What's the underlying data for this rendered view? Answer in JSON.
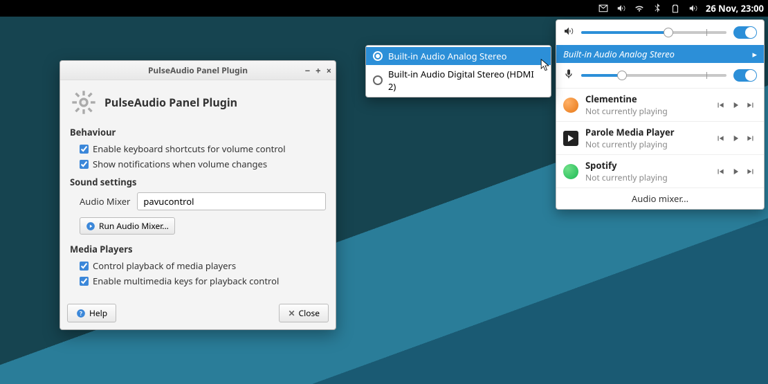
{
  "panel": {
    "clock": "26 Nov, 23:00"
  },
  "dialog": {
    "title": "PulseAudio Panel Plugin",
    "heading": "PulseAudio Panel Plugin",
    "sections": {
      "behaviour": "Behaviour",
      "sound": "Sound settings",
      "media": "Media Players"
    },
    "checkboxes": {
      "kbd": "Enable keyboard shortcuts for volume control",
      "notify": "Show notifications when volume changes",
      "controlPlayers": "Control playback of media players",
      "mmKeys": "Enable multimedia keys for playback control"
    },
    "mixer": {
      "label": "Audio Mixer",
      "value": "pavucontrol",
      "run": "Run Audio Mixer..."
    },
    "buttons": {
      "help": "Help",
      "close": "Close"
    }
  },
  "popover": {
    "output": {
      "device": "Built-in Audio Analog Stereo",
      "percent": 60
    },
    "input": {
      "percent": 28
    },
    "apps": [
      {
        "name": "Clementine",
        "status": "Not currently playing",
        "icon": "clementine"
      },
      {
        "name": "Parole Media Player",
        "status": "Not currently playing",
        "icon": "parole"
      },
      {
        "name": "Spotify",
        "status": "Not currently playing",
        "icon": "spotify"
      }
    ],
    "mixerLink": "Audio mixer..."
  },
  "submenu": {
    "items": [
      {
        "label": "Built-in Audio Analog Stereo",
        "selected": true
      },
      {
        "label": "Built-in Audio Digital Stereo (HDMI 2)",
        "selected": false
      }
    ]
  }
}
